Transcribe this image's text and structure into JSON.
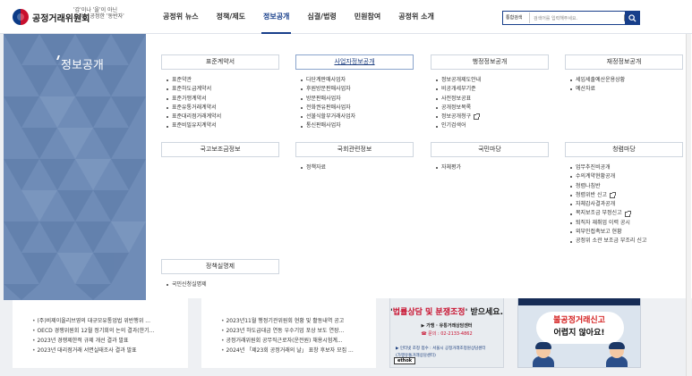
{
  "header": {
    "logo_text": "공정거래위원회",
    "slogan_line1": "'갑'이나 '을'이 아닌",
    "slogan_line2": "우리는 공정한 '동반자'",
    "nav": [
      "공정위 뉴스",
      "정책/제도",
      "정보공개",
      "심결/법령",
      "민원참여",
      "공정위 소개"
    ],
    "active_nav_index": 2,
    "search": {
      "select_value": "통합검색",
      "placeholder": "검색어를 입력해주세요."
    }
  },
  "mega_menu": {
    "title": "정보공개",
    "categories": [
      {
        "title": "표준계약서",
        "items": [
          {
            "label": "표준약관"
          },
          {
            "label": "표준하도급계약서"
          },
          {
            "label": "표준가맹계약서"
          },
          {
            "label": "표준유통거래계약서"
          },
          {
            "label": "표준대리점거래계약서"
          },
          {
            "label": "표준비밀유지계약서"
          }
        ]
      },
      {
        "title": "사업자정보공개",
        "active": true,
        "items": [
          {
            "label": "다단계판매사업자"
          },
          {
            "label": "후원방문판매사업자"
          },
          {
            "label": "방문판매사업자"
          },
          {
            "label": "전화권유판매사업자"
          },
          {
            "label": "선불식할부거래사업자"
          },
          {
            "label": "통신판매사업자"
          }
        ]
      },
      {
        "title": "행정정보공개",
        "items": [
          {
            "label": "정보공개제도안내"
          },
          {
            "label": "비공개세부기준"
          },
          {
            "label": "사전정보공표"
          },
          {
            "label": "공개정보목록"
          },
          {
            "label": "정보공개청구",
            "external": true
          },
          {
            "label": "인기검색어"
          }
        ]
      },
      {
        "title": "재정정보공개",
        "items": [
          {
            "label": "세입세출예산운용상황"
          },
          {
            "label": "예산자료"
          }
        ]
      },
      {
        "title": "국고보조금정보",
        "items": []
      },
      {
        "title": "국회관련정보",
        "items": [
          {
            "label": "정책자료"
          }
        ]
      },
      {
        "title": "국민마당",
        "items": [
          {
            "label": "자체평가"
          }
        ]
      },
      {
        "title": "청렴마당",
        "items": [
          {
            "label": "업무추진비공개"
          },
          {
            "label": "수의계약현황공개"
          },
          {
            "label": "청렴나침반"
          },
          {
            "label": "청렴위반 신고",
            "external": true
          },
          {
            "label": "자체감사결과공개"
          },
          {
            "label": "복지보조금 부정신고",
            "external": true
          },
          {
            "label": "퇴직자 재취업 이력 공시"
          },
          {
            "label": "외부인접촉보고 현황"
          },
          {
            "label": "공정위 소관 보조금 부조리 신고"
          }
        ]
      },
      {
        "title": "정책실명제",
        "items": [
          {
            "label": "국민신청실명제"
          }
        ]
      }
    ]
  },
  "news_left": [
    "(주)비제이올리브영의 대규모유통업법 위반행위 ...",
    "OECD 경쟁위원회 12월 정기회의 논의 결과(한기...",
    "2023년 경쟁제한적 규제 개선 결과 발표",
    "2023년 대리점거래 서면실태조사 결과 발표"
  ],
  "news_right": [
    "2023년11월 행정기관위원회 현황 및 활동내역 공고",
    "2023년 하도급대금 연동 우수기업 포상 보도 연장...",
    "공정거래위원회 공무직근로자(운전원) 채용시험계...",
    "2024년 「제23회 공정거래의 날」 표창 후보자 모집 ..."
  ],
  "banner1": {
    "headline_prefix": "'",
    "headline_highlight": "법률상담 및 분쟁조정",
    "headline_suffix": "' 받으세요.",
    "line1": "▶ 가맹 · 유통거래상담센터",
    "line2": "☎ 문의 : 02-2133-4862",
    "line3": "▶ 인터넷 조정 접수 : 서울시 공정거래조정원상담센터",
    "line4": "(가맹유통거래상담센터)",
    "logo": "ethok"
  },
  "banner2": {
    "line1": "불공정거래신고",
    "line2": "어렵지 않아요!"
  },
  "colors": {
    "brand": "#173e8a",
    "menu_panel": "#6f8cb7",
    "alert_red": "#d42020"
  }
}
